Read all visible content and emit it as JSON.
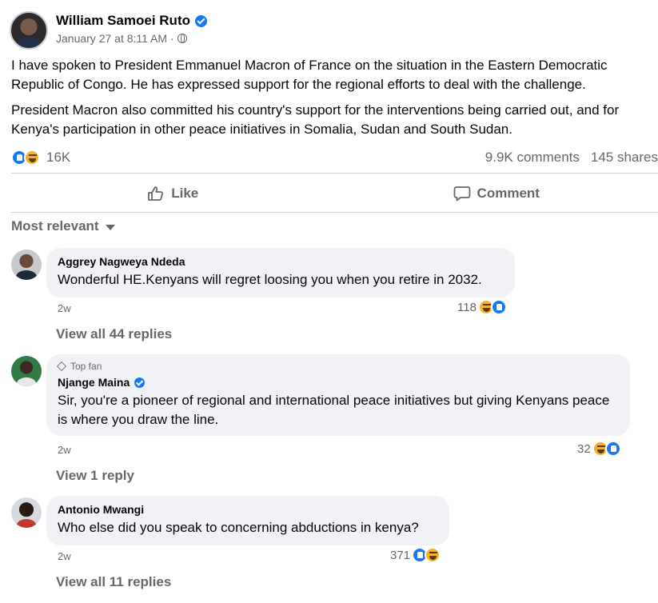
{
  "post": {
    "author": "William Samoei Ruto",
    "timestamp": "January 27 at 8:11 AM · ",
    "paragraphs": [
      "I have spoken to President Emmanuel Macron of France on the situation in the Eastern Democratic Republic of Congo. He has expressed support for the regional efforts to deal with the challenge.",
      "President Macron also committed his country's support for the interventions being carried out, and for Kenya's participation in other peace initiatives in Somalia, Sudan and South Sudan."
    ],
    "reactions_count": "16K",
    "comments_count": "9.9K comments",
    "shares_count": "145 shares"
  },
  "actions": {
    "like_label": "Like",
    "comment_label": "Comment"
  },
  "sort": {
    "label": "Most relevant"
  },
  "comments": [
    {
      "author": "Aggrey Nagweya Ndeda",
      "text": "Wonderful HE.Kenyans will regret loosing you when you retire in 2032.",
      "time": "2w",
      "reactions": "118",
      "replies_link": "View all 44 replies"
    },
    {
      "badge": "Top fan",
      "author": "Njange Maina",
      "text": "Sir, you're a pioneer of regional and international peace initiatives but giving Kenyans peace is where you draw the line.",
      "time": "2w",
      "reactions": "32",
      "replies_link": "View 1 reply"
    },
    {
      "author": "Antonio Mwangi",
      "text": "Who else did you speak to concerning abductions in kenya?",
      "time": "2w",
      "reactions": "371",
      "replies_link": "View all 11 replies"
    }
  ],
  "colors": {
    "accent": "#1877f2",
    "muted": "#65676b",
    "bubble": "#f0f2f5",
    "haha": "#f7b125"
  },
  "icons": [
    "verified-icon",
    "globe-icon",
    "like-reaction-icon",
    "haha-reaction-icon",
    "thumbs-up-icon",
    "comment-icon",
    "caret-down-icon",
    "diamond-icon"
  ]
}
